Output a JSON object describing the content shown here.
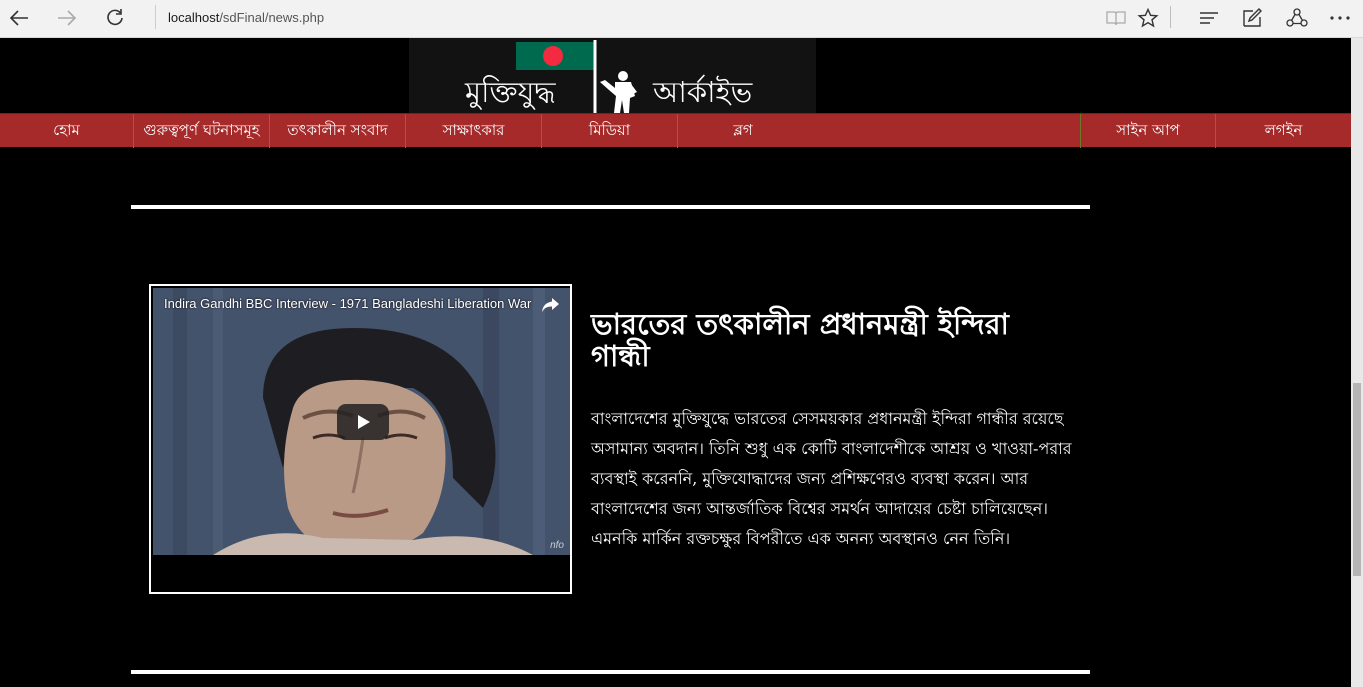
{
  "browser": {
    "url_host": "localhost",
    "url_path": "/sdFinal/news.php"
  },
  "site": {
    "logo_left": "মুক্তিযুদ্ধ",
    "logo_right": "আর্কাইভ",
    "flag_colors": {
      "green": "#006a4e",
      "red": "#f42a41"
    }
  },
  "nav": {
    "items": [
      {
        "label": "হোম"
      },
      {
        "label": "গুরুত্বপূর্ণ ঘটনাসমূহ"
      },
      {
        "label": "তৎকালীন সংবাদ"
      },
      {
        "label": "সাক্ষাৎকার"
      },
      {
        "label": "মিডিয়া"
      },
      {
        "label": "ব্লগ"
      }
    ],
    "right_items": [
      {
        "label": "সাইন আপ"
      },
      {
        "label": "লগইন"
      }
    ],
    "bar_color": "#a62a2a"
  },
  "article": {
    "video": {
      "title": "Indira Gandhi BBC Interview - 1971 Bangladeshi Liberation War",
      "watermark": "nfo"
    },
    "headline": "ভারতের তৎকালীন প্রধানমন্ত্রী ইন্দিরা গান্ধী",
    "body": "বাংলাদেশের মুক্তিযুদ্ধে ভারতের সেসময়কার প্রধানমন্ত্রী ইন্দিরা গান্ধীর রয়েছে অসামান্য অবদান। তিনি শুধু এক কোটি বাংলাদেশীকে আশ্রয় ও খাওয়া-পরার ব্যবস্থাই করেননি, মুক্তিযোদ্ধাদের জন্য প্রশিক্ষণেরও ব্যবস্থা করেন। আর বাংলাদেশের জন্য আন্তর্জাতিক বিশ্বের সমর্থন আদায়ের চেষ্টা চালিয়েছেন। এমনকি মার্কিন রক্তচক্ষুর বিপরীতে এক অনন্য অবস্থানও নেন তিনি।"
  }
}
